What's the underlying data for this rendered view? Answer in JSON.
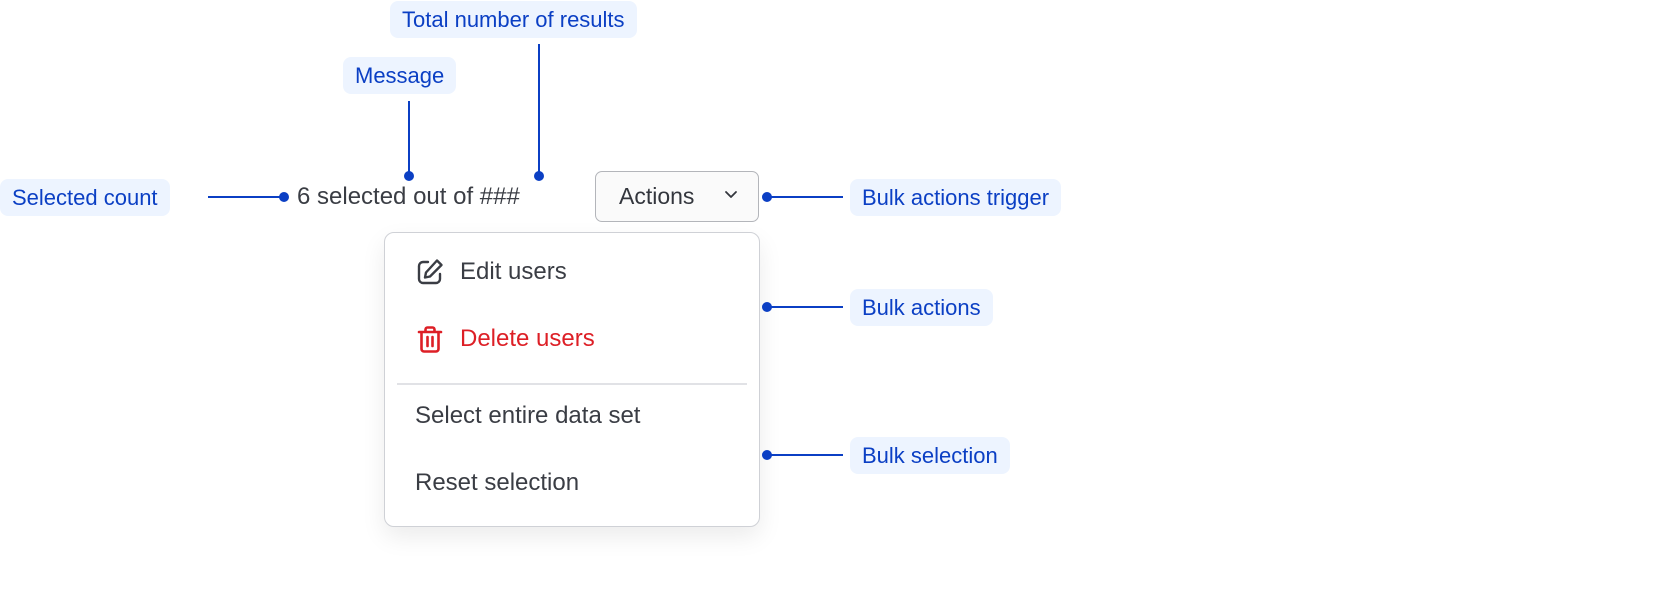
{
  "callouts": {
    "total_results": "Total number of results",
    "message": "Message",
    "selected_count": "Selected count",
    "bulk_actions_trigger": "Bulk actions trigger",
    "bulk_actions": "Bulk actions",
    "bulk_selection": "Bulk selection"
  },
  "selection": {
    "message": "6 selected out of ###",
    "selected_count": 6,
    "total": "###"
  },
  "actions_button": {
    "label": "Actions",
    "icon": "chevron-down-icon"
  },
  "menu": {
    "bulk_actions": [
      {
        "label": "Edit users",
        "icon": "edit-icon",
        "variant": "default"
      },
      {
        "label": "Delete users",
        "icon": "trash-icon",
        "variant": "danger"
      }
    ],
    "bulk_selection": [
      {
        "label": "Select entire data set"
      },
      {
        "label": "Reset selection"
      }
    ]
  },
  "colors": {
    "annotation": "#0b3fc4",
    "annotation_bg": "#edf4ff",
    "danger": "#dd1f26",
    "text": "#3a3d44"
  }
}
